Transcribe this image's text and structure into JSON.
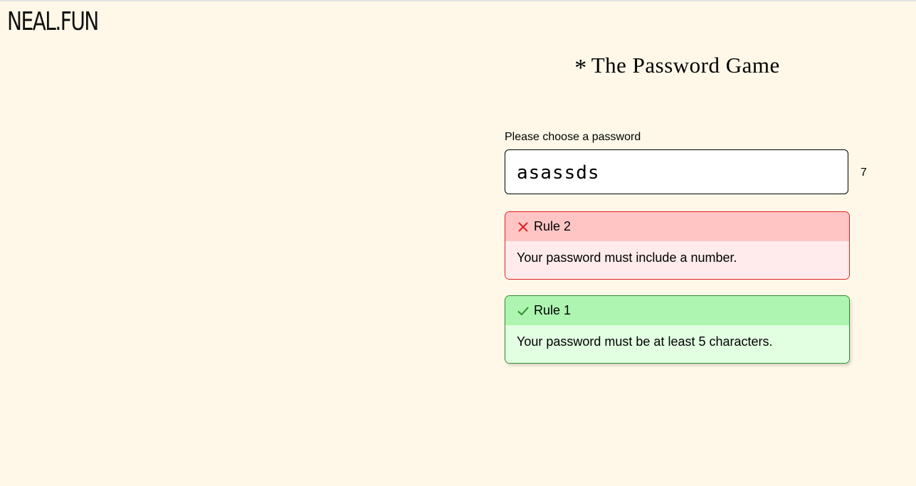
{
  "site": {
    "logo": "NEAL.FUN"
  },
  "page": {
    "title_icon": "*",
    "title": "The Password Game",
    "password_label": "Please choose a password",
    "password_value": "asassds",
    "char_count": "7"
  },
  "rules": [
    {
      "status": "fail",
      "icon": "x-icon",
      "title": "Rule 2",
      "text": "Your password must include a number.",
      "colors": {
        "border": "#e02020",
        "header": "#ffc5c5",
        "body": "#ffebeb",
        "icon": "#e02020"
      }
    },
    {
      "status": "pass",
      "icon": "check-icon",
      "title": "Rule 1",
      "text": "Your password must be at least 5 characters.",
      "colors": {
        "border": "#2e8b2e",
        "header": "#adf5b0",
        "body": "#e2ffe2",
        "icon": "#2e8b2e"
      }
    }
  ],
  "colors": {
    "background": "#fff8e8"
  }
}
